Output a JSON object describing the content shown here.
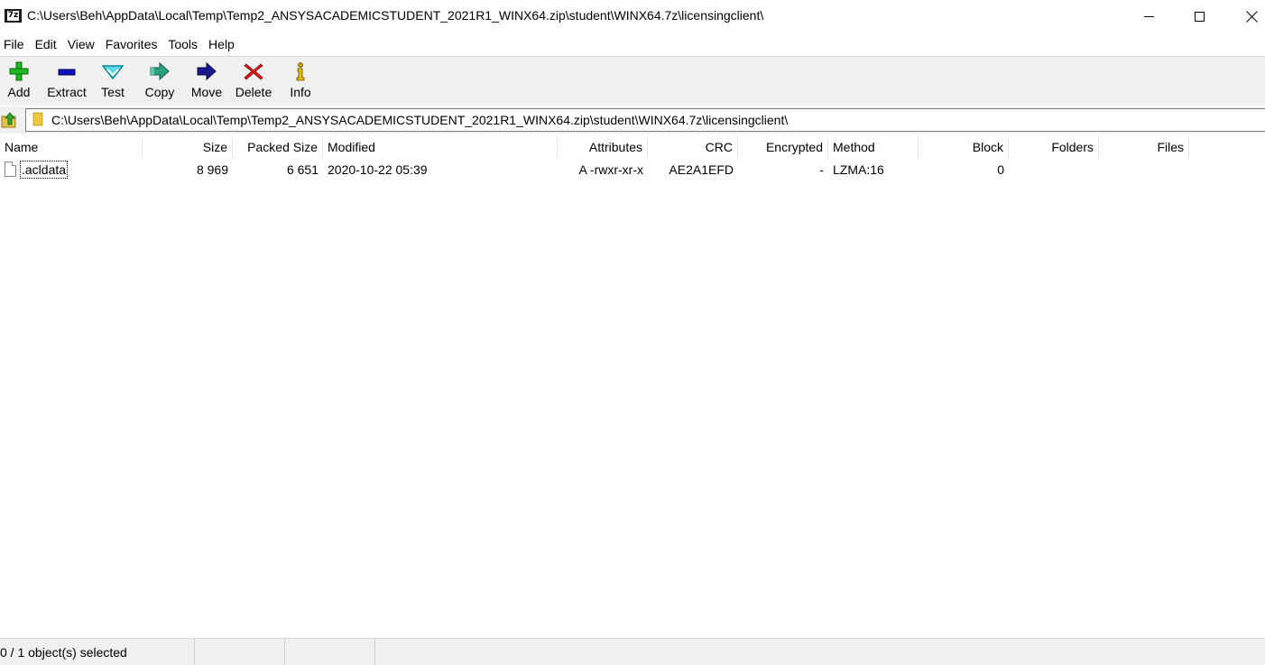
{
  "window": {
    "title": "C:\\Users\\Beh\\AppData\\Local\\Temp\\Temp2_ANSYSACADEMICSTUDENT_2021R1_WINX64.zip\\student\\WINX64.7z\\licensingclient\\",
    "app_icon_text": "7z"
  },
  "menu": [
    "File",
    "Edit",
    "View",
    "Favorites",
    "Tools",
    "Help"
  ],
  "toolbar": [
    {
      "label": "Add",
      "icon": "plus-icon",
      "color": "#1fb81f"
    },
    {
      "label": "Extract",
      "icon": "minus-icon",
      "color": "#1010c0"
    },
    {
      "label": "Test",
      "icon": "check-icon",
      "color": "#1ab7c9"
    },
    {
      "label": "Copy",
      "icon": "copy-arrow-icon",
      "color": "#1a9a7a"
    },
    {
      "label": "Move",
      "icon": "move-arrow-icon",
      "color": "#1a1a8c"
    },
    {
      "label": "Delete",
      "icon": "delete-x-icon",
      "color": "#e01818"
    },
    {
      "label": "Info",
      "icon": "info-icon",
      "color": "#c8a000"
    }
  ],
  "address": {
    "path": "C:\\Users\\Beh\\AppData\\Local\\Temp\\Temp2_ANSYSACADEMICSTUDENT_2021R1_WINX64.zip\\student\\WINX64.7z\\licensingclient\\"
  },
  "columns": [
    "Name",
    "Size",
    "Packed Size",
    "Modified",
    "Attributes",
    "CRC",
    "Encrypted",
    "Method",
    "Block",
    "Folders",
    "Files"
  ],
  "rows": [
    {
      "name": ".acldata",
      "size": "8 969",
      "packed_size": "6 651",
      "modified": "2020-10-22 05:39",
      "attributes": "A -rwxr-xr-x",
      "crc": "AE2A1EFD",
      "encrypted": "-",
      "method": "LZMA:16",
      "block": "0",
      "folders": "",
      "files": ""
    }
  ],
  "status": {
    "selection": "0 / 1 object(s) selected",
    "pane2": "",
    "pane3": ""
  }
}
